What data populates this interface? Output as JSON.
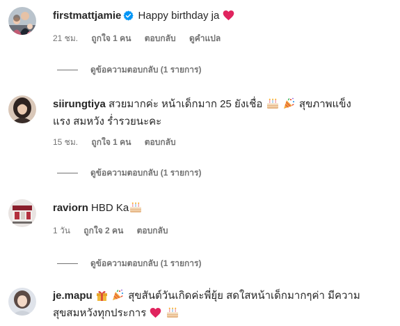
{
  "comments": [
    {
      "username": "firstmattjamie",
      "verified": true,
      "text": "Happy birthday ja",
      "emojis": [
        "heart"
      ],
      "time": "21 ชม.",
      "likes": "ถูกใจ 1 คน",
      "reply": "ตอบกลับ",
      "translate": "ดูคำแปล",
      "view_replies": "ดูข้อความตอบกลับ (1 รายการ)"
    },
    {
      "username": "siirungtiya",
      "verified": false,
      "text_part1": "สวยมากค่ะ หน้าเด็กมาก 25 ยังเชื่อ",
      "text_part2": "สุขภาพแข็ง",
      "text_line2": "แรง สมหวัง ร่ำรวยนะคะ",
      "emojis": [
        "cake",
        "party-popper"
      ],
      "time": "15 ชม.",
      "likes": "ถูกใจ 1 คน",
      "reply": "ตอบกลับ",
      "view_replies": "ดูข้อความตอบกลับ (1 รายการ)"
    },
    {
      "username": "raviorn",
      "verified": false,
      "text": "HBD Ka",
      "emojis": [
        "cake"
      ],
      "time": "1 วัน",
      "likes": "ถูกใจ 2 คน",
      "reply": "ตอบกลับ",
      "view_replies": "ดูข้อความตอบกลับ (1 รายการ)"
    },
    {
      "username": "je.mapu",
      "verified": false,
      "text_part1": "สุขสันต์วันเกิดค่ะพี่ยุ้ย สดใสหน้าเด็กมากๆค่า มีความ",
      "text_line2": "สุขสมหวังทุกประการ",
      "emojis": [
        "gift",
        "party-popper",
        "heart",
        "cake"
      ]
    }
  ],
  "colors": {
    "text": "#262626",
    "secondary": "#737373",
    "verified": "#0095f6",
    "heart": "#e0245e"
  }
}
